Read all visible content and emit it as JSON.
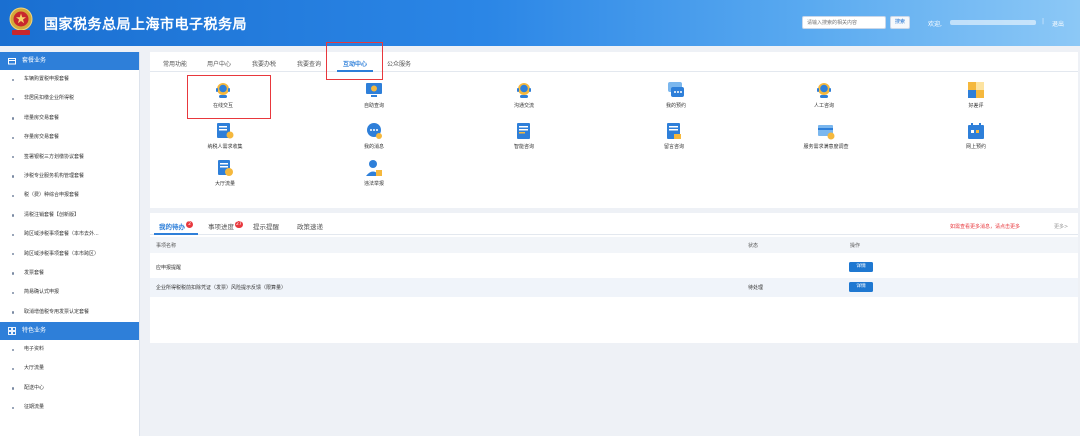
{
  "header": {
    "title": "国家税务总局上海市电子税务局",
    "search_placeholder": "请输入搜索的相关内容",
    "search_button": "搜索",
    "welcome": "欢迎,",
    "separator": "|",
    "logout": "退出"
  },
  "sidebar": {
    "section1": "套餐业务",
    "items1": [
      "车辆购置税申报套餐",
      "非居民扣缴企业所得税",
      "增量房交易套餐",
      "存量房交易套餐",
      "签署银税三方划缴协议套餐",
      "涉税专业服务机构管理套餐",
      "税（费）种综合申报套餐",
      "清税注销套餐【创新版】",
      "跨区域涉税事项套餐（本市去外...",
      "跨区域涉税事项套餐（本市跨区）",
      "发票套餐",
      "简易确认式申报",
      "取消增值税专用发票认定套餐"
    ],
    "section2": "特色业务",
    "items2": [
      "电子资料",
      "大厅流量",
      "配送中心",
      "征期流量"
    ]
  },
  "top_tabs": [
    "常用功能",
    "用户中心",
    "我要办税",
    "我要查询",
    "互动中心",
    "公众服务"
  ],
  "functions": [
    {
      "label": "在线交互",
      "icon": "headset-icon"
    },
    {
      "label": "自助查询",
      "icon": "monitor-search-icon"
    },
    {
      "label": "沟通交流",
      "icon": "headset-icon"
    },
    {
      "label": "我的预约",
      "icon": "chat-icon"
    },
    {
      "label": "人工咨询",
      "icon": "headset-icon"
    },
    {
      "label": "好差评",
      "icon": "star-rating-icon"
    },
    {
      "label": "纳税人需求收集",
      "icon": "list-user-icon"
    },
    {
      "label": "我的消息",
      "icon": "message-icon"
    },
    {
      "label": "智能咨询",
      "icon": "document-icon"
    },
    {
      "label": "留言咨询",
      "icon": "document-icon"
    },
    {
      "label": "服务需求满意度调查",
      "icon": "card-icon"
    },
    {
      "label": "网上预约",
      "icon": "calendar-icon"
    },
    {
      "label": "大厅流量",
      "icon": "document-clock-icon"
    },
    {
      "label": "违法举报",
      "icon": "user-report-icon"
    }
  ],
  "bottom": {
    "tabs": [
      {
        "label": "我的待办",
        "badge": "2"
      },
      {
        "label": "事项进度",
        "badge": "27"
      },
      {
        "label": "提示提醒",
        "badge": ""
      },
      {
        "label": "政策速递",
        "badge": ""
      }
    ],
    "notice": "如需查看更多消息，请点击更多",
    "more": "更多>",
    "columns": [
      "事项名称",
      "状态",
      "操作"
    ],
    "rows": [
      {
        "name": "应申报提醒",
        "status": "",
        "action": "详情"
      },
      {
        "name": "企业所得税税前扣除凭证（发票）风险提示反馈（限算量）",
        "status": "待处理",
        "action": "详情"
      }
    ]
  },
  "colors": {
    "primary": "#2e7fd9",
    "highlight": "#e8383d",
    "header_start": "#1a6fd1",
    "header_end": "#8cc8f6"
  }
}
